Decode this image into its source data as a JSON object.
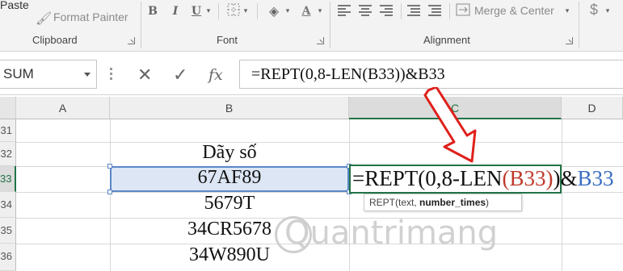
{
  "ribbon": {
    "paste_label": "Paste",
    "format_painter_label": "Format Painter",
    "clipboard_label": "Clipboard",
    "font_label": "Font",
    "alignment_label": "Alignment",
    "bold": "B",
    "italic": "I",
    "underline": "U",
    "merge_label": "Merge & Center",
    "currency_symbol": "$",
    "accent": "#217346"
  },
  "formula_bar": {
    "name_box": "SUM",
    "cancel_icon": "close-icon",
    "enter_icon": "check-icon",
    "fx_label": "fx",
    "formula": "=REPT(0,8-LEN(B33))&B33"
  },
  "grid": {
    "columns": [
      "A",
      "B",
      "C",
      "D"
    ],
    "active_column": "C",
    "rows": [
      "31",
      "32",
      "33",
      "34",
      "35",
      "36"
    ],
    "active_row": "33",
    "cells": {
      "b32": "Dãy số",
      "b33": "67AF89",
      "b34": "5679T",
      "b35": "34CR5678",
      "b36": "34W890U"
    },
    "edit_cell": {
      "part1": "=REPT(0,8-LEN",
      "paren_open": "(",
      "ref_red": "B33",
      "paren_close": ")",
      "part2": ")&",
      "ref_blue": "B33"
    },
    "tooltip": {
      "func": "REPT(text, ",
      "arg_bold": "number_times",
      "close": ")"
    }
  },
  "watermark": "Quantrimang"
}
